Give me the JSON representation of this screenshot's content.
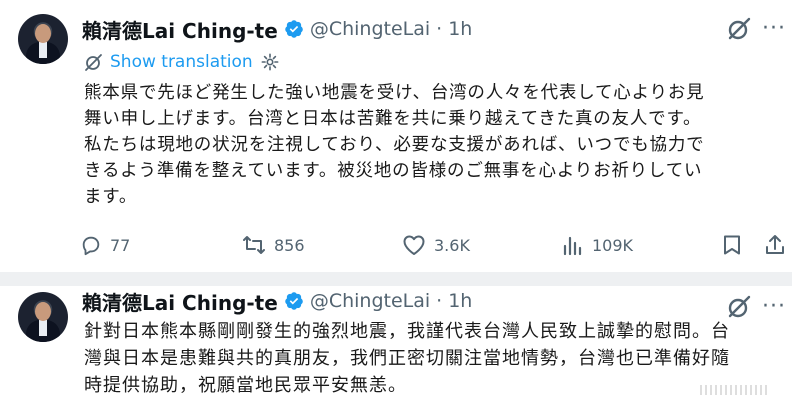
{
  "tweets": [
    {
      "author": {
        "name": "賴清德Lai Ching-te",
        "handle": "@ChingteLai",
        "separator": "·",
        "time": "1h"
      },
      "translation_link": "Show translation",
      "lines": [
        "熊本県で先ほど発生した強い地震を受け、台湾の人々を代表して心よりお見",
        "舞い申し上げます。台湾と日本は苦難を共に乗り越えてきた真の友人です。",
        "私たちは現地の状況を注視しており、必要な支援があれば、いつでも協力で",
        "きるよう準備を整えています。被災地の皆様のご無事を心よりお祈りしてい",
        "ます。"
      ],
      "stats": {
        "replies": "77",
        "reposts": "856",
        "likes": "3.6K",
        "views": "109K"
      }
    },
    {
      "author": {
        "name": "賴清德Lai Ching-te",
        "handle": "@ChingteLai",
        "separator": "·",
        "time": "1h"
      },
      "lines": [
        "針對日本熊本縣剛剛發生的強烈地震，我謹代表台灣人民致上誠摯的慰問。台",
        "灣與日本是患難與共的真朋友，我們正密切關注當地情勢，台灣也已準備好隨",
        "時提供協助，祝願當地民眾平安無恙。"
      ]
    }
  ],
  "icons": {
    "verified": "verified-badge-icon",
    "grok": "grok-icon",
    "more": "more-dots-icon",
    "translate": "translate-icon",
    "settings": "gear-icon",
    "reply": "reply-icon",
    "repost": "repost-icon",
    "like": "heart-icon",
    "views": "views-icon",
    "bookmark": "bookmark-icon",
    "share": "share-icon"
  },
  "colors": {
    "link": "#1d9bf0",
    "verified": "#1d9bf0",
    "muted": "#536471",
    "separator": "#eef0f2"
  }
}
